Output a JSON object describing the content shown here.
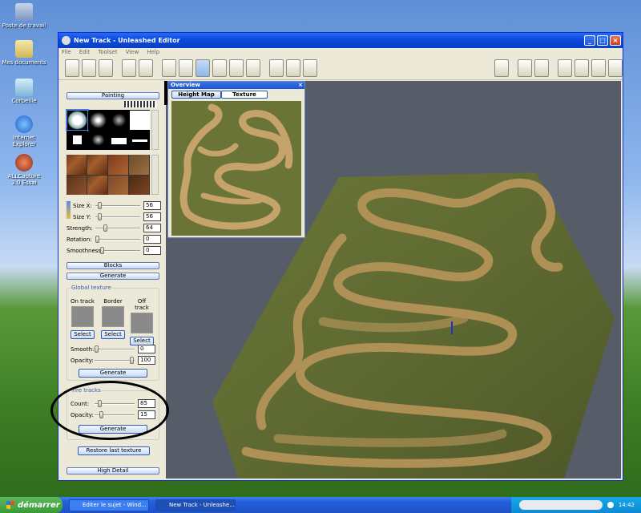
{
  "desktop": {
    "icons": [
      {
        "label": "Poste de travail"
      },
      {
        "label": "Mes documents"
      },
      {
        "label": "Corbeille"
      },
      {
        "label": "Internet Explorer"
      },
      {
        "label": "ALLCapture 3.0 Essai"
      }
    ]
  },
  "window": {
    "title": "New Track - Unleashed Editor",
    "menu": [
      "File",
      "Edit",
      "Toolset",
      "View",
      "Help"
    ]
  },
  "panel": {
    "painting_label": "Painting",
    "size_x_label": "Size X:",
    "size_x_value": "56",
    "size_y_label": "Size Y:",
    "size_y_value": "56",
    "strength_label": "Strength:",
    "strength_value": "64",
    "rotation_label": "Rotation:",
    "rotation_value": "0",
    "smoothness_label": "Smoothness:",
    "smoothness_value": "0",
    "blocks_label": "Blocks",
    "generate_label": "Generate",
    "global_texture_title": "Global texture",
    "on_track": "On track",
    "border": "Border",
    "off_track": "Off track",
    "select_label": "Select",
    "smooth_label": "Smooth:",
    "smooth_value": "0",
    "opacity_label": "Opacity:",
    "opacity_value": "100",
    "generate2_label": "Generate",
    "tire_tracks_title": "Tire tracks",
    "count_label": "Count:",
    "count_value": "85",
    "tire_opacity_label": "Opacity:",
    "tire_opacity_value": "15",
    "generate3_label": "Generate",
    "restore_label": "Restore last texture",
    "high_detail_label": "High Detail"
  },
  "overview": {
    "title": "Overview",
    "close": "×",
    "tab_height": "Height Map",
    "tab_texture": "Texture"
  },
  "taskbar": {
    "start": "démarrer",
    "task1": "Editer le sujet - Wind...",
    "task2": "New Track - Unleashe...",
    "clock": "14:42"
  },
  "colors": {
    "titlebar": "#0b4ae0",
    "viewport_bg": "#565c68",
    "terrain_grass": "#6e7a3a",
    "track_dirt": "#b8955a"
  }
}
